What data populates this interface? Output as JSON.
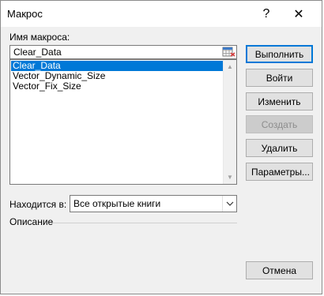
{
  "window": {
    "title": "Макрос",
    "help_symbol": "?",
    "close_symbol": "✕"
  },
  "macro_name": {
    "label": "Имя макроса:",
    "value": "Clear_Data"
  },
  "macro_list": {
    "items": [
      {
        "label": "Clear_Data",
        "selected": true
      },
      {
        "label": "Vector_Dynamic_Size",
        "selected": false
      },
      {
        "label": "Vector_Fix_Size",
        "selected": false
      }
    ]
  },
  "buttons": {
    "run": "Выполнить",
    "step_into": "Войти",
    "edit": "Изменить",
    "create": "Создать",
    "delete": "Удалить",
    "options": "Параметры...",
    "cancel": "Отмена"
  },
  "location": {
    "label": "Находится в:",
    "value": "Все открытые книги"
  },
  "description": {
    "label": "Описание"
  },
  "colors": {
    "selection": "#0078d7",
    "dialog_bg": "#f0f0f0"
  }
}
